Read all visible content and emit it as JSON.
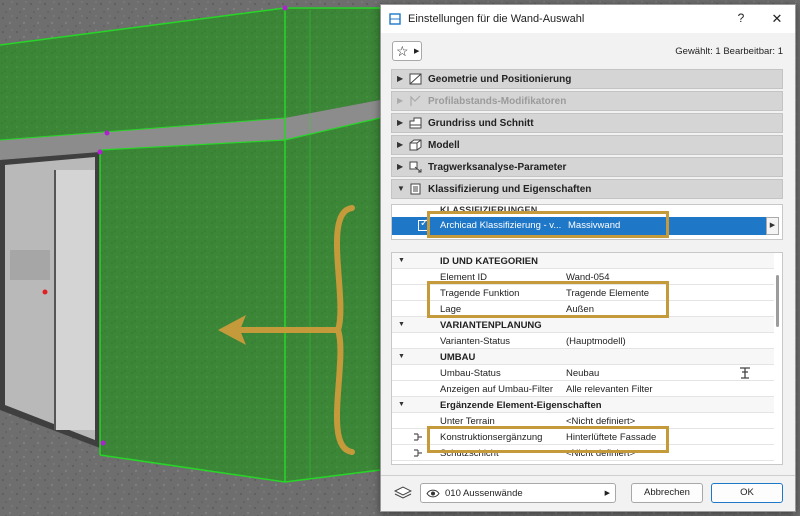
{
  "dialog": {
    "title": "Einstellungen für die Wand-Auswahl",
    "help_label": "?",
    "close_label": "✕",
    "selection_info": "Gewählt: 1 Bearbeitbar: 1"
  },
  "sections": [
    {
      "label": "Geometrie und Positionierung",
      "icon": "geometry-icon",
      "enabled": true
    },
    {
      "label": "Profilabstands-Modifikatoren",
      "icon": "profile-modifier-icon",
      "enabled": false
    },
    {
      "label": "Grundriss und Schnitt",
      "icon": "floorplan-icon",
      "enabled": true
    },
    {
      "label": "Modell",
      "icon": "model-icon",
      "enabled": true
    },
    {
      "label": "Tragwerksanalyse-Parameter",
      "icon": "structural-analysis-icon",
      "enabled": true
    },
    {
      "label": "Klassifizierung und Eigenschaften",
      "icon": "classification-icon",
      "enabled": true,
      "expanded": true
    }
  ],
  "classification": {
    "header": "KLASSIFIZIERUNGEN",
    "system": "Archicad Klassifizierung - v...",
    "value": "Massivwand",
    "checked": true
  },
  "properties": {
    "groups": [
      {
        "title": "ID UND KATEGORIEN",
        "rows": [
          {
            "name": "Element ID",
            "value": "Wand-054"
          },
          {
            "name": "Tragende Funktion",
            "value": "Tragende Elemente"
          },
          {
            "name": "Lage",
            "value": "Außen"
          }
        ]
      },
      {
        "title": "VARIANTENPLANUNG",
        "rows": [
          {
            "name": "Varianten-Status",
            "value": "(Hauptmodell)"
          }
        ]
      },
      {
        "title": "UMBAU",
        "rows": [
          {
            "name": "Umbau-Status",
            "value": "Neubau"
          },
          {
            "name": "Anzeigen auf Umbau-Filter",
            "value": "Alle relevanten Filter"
          }
        ]
      },
      {
        "title": "Ergänzende Element-Eigenschaften",
        "rows": [
          {
            "name": "Unter Terrain",
            "value": "<Nicht definiert>"
          },
          {
            "name": "Konstruktionsergänzung",
            "value": "Hinterlüftete Fassade"
          },
          {
            "name": "Schutzschicht",
            "value": "<Nicht definiert>"
          }
        ]
      }
    ]
  },
  "footer": {
    "layer": "010 Aussenwände",
    "cancel_label": "Abbrechen",
    "ok_label": "OK"
  },
  "colors": {
    "selection_blue": "#1f77c8",
    "highlight_gold": "#c49a3a",
    "wall_green": "#3f8a3a"
  }
}
